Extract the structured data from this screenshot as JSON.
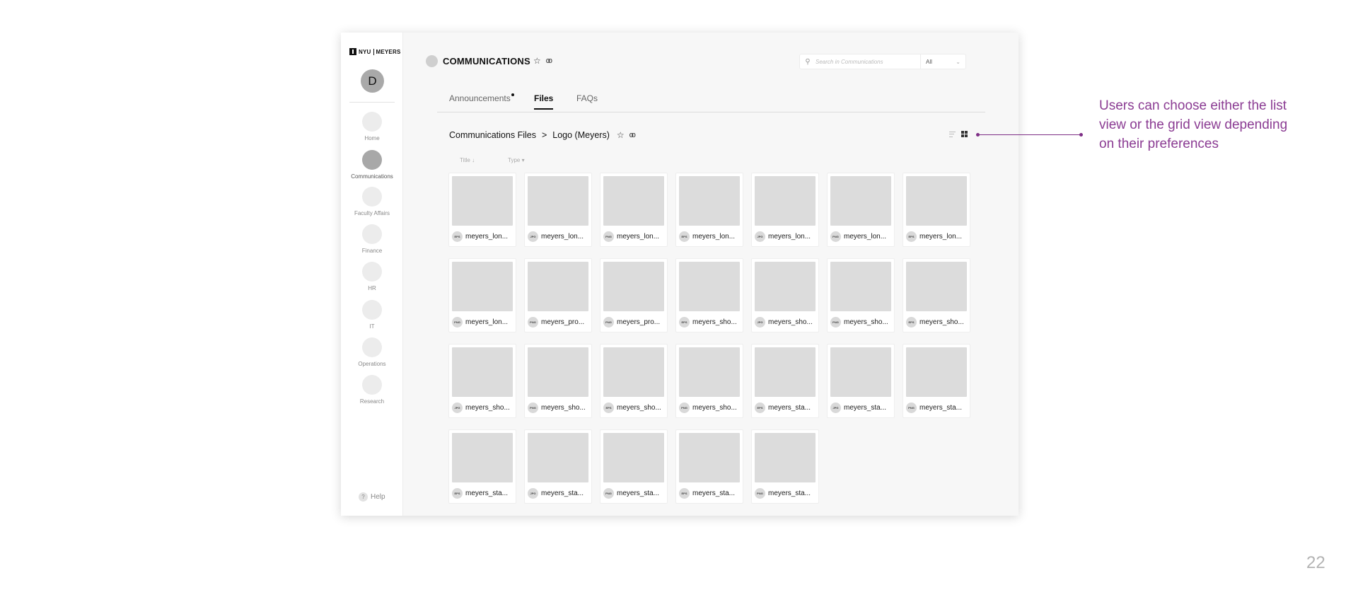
{
  "sidebar": {
    "logo": {
      "left": "NYU",
      "right": "MEYERS"
    },
    "avatar_initial": "D",
    "items": [
      {
        "label": "Home"
      },
      {
        "label": "Communications"
      },
      {
        "label": "Faculty Affairs"
      },
      {
        "label": "Finance"
      },
      {
        "label": "HR"
      },
      {
        "label": "IT"
      },
      {
        "label": "Operations"
      },
      {
        "label": "Research"
      }
    ],
    "active_item": "Communications",
    "help_label": "Help"
  },
  "header": {
    "title": "COMMUNICATIONS",
    "search_placeholder": "Search in Communications",
    "search_scope": "All"
  },
  "tabs": [
    {
      "label": "Announcements",
      "has_dot": true
    },
    {
      "label": "Files",
      "active": true
    },
    {
      "label": "FAQs"
    }
  ],
  "breadcrumb": {
    "root": "Communications Files",
    "separator": ">",
    "current": "Logo (Meyers)"
  },
  "view": {
    "mode": "grid"
  },
  "columns": [
    {
      "label": "Title",
      "arrow": "↓"
    },
    {
      "label": "Type",
      "arrow": "▾"
    }
  ],
  "files": [
    {
      "type": "EPS",
      "name": "meyers_lon..."
    },
    {
      "type": "JPG",
      "name": "meyers_lon..."
    },
    {
      "type": "PNG",
      "name": "meyers_lon..."
    },
    {
      "type": "EPS",
      "name": "meyers_lon..."
    },
    {
      "type": "JPG",
      "name": "meyers_lon..."
    },
    {
      "type": "PNG",
      "name": "meyers_lon..."
    },
    {
      "type": "EPS",
      "name": "meyers_lon..."
    },
    {
      "type": "PNG",
      "name": "meyers_lon..."
    },
    {
      "type": "PNG",
      "name": "meyers_pro..."
    },
    {
      "type": "PNG",
      "name": "meyers_pro..."
    },
    {
      "type": "EPS",
      "name": "meyers_sho..."
    },
    {
      "type": "JPG",
      "name": "meyers_sho..."
    },
    {
      "type": "PNG",
      "name": "meyers_sho..."
    },
    {
      "type": "EPS",
      "name": "meyers_sho..."
    },
    {
      "type": "JPG",
      "name": "meyers_sho..."
    },
    {
      "type": "PNG",
      "name": "meyers_sho..."
    },
    {
      "type": "EPS",
      "name": "meyers_sho..."
    },
    {
      "type": "PNG",
      "name": "meyers_sho..."
    },
    {
      "type": "EPS",
      "name": "meyers_sta..."
    },
    {
      "type": "JPG",
      "name": "meyers_sta..."
    },
    {
      "type": "PNG",
      "name": "meyers_sta..."
    },
    {
      "type": "EPS",
      "name": "meyers_sta..."
    },
    {
      "type": "JPG",
      "name": "meyers_sta..."
    },
    {
      "type": "PNG",
      "name": "meyers_sta..."
    },
    {
      "type": "EPS",
      "name": "meyers_sta..."
    },
    {
      "type": "PNG",
      "name": "meyers_sta..."
    }
  ],
  "annotation": {
    "text": "Users can choose either the list view or the grid view depending on their preferences",
    "color": "#8b3c93"
  },
  "page_number": "22",
  "icons": [
    "search-icon",
    "star-icon",
    "link-icon",
    "list-view-icon",
    "grid-view-icon",
    "help-icon"
  ]
}
